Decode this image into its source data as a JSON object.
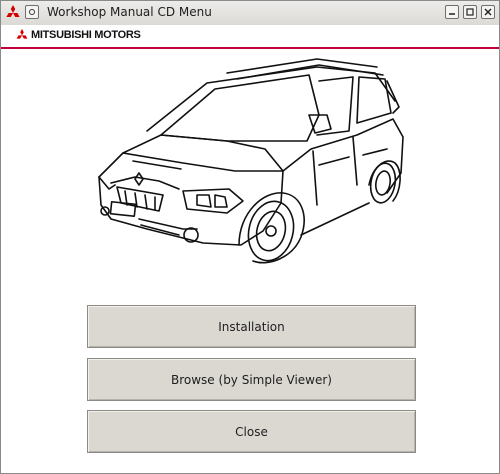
{
  "window": {
    "title": "Workshop Manual CD Menu",
    "controls": [
      "minimize-icon",
      "maximize-icon",
      "close-icon"
    ]
  },
  "brand": {
    "name": "MITSUBISHI MOTORS",
    "accent_color": "#c4003a",
    "logo_color": "#d40000"
  },
  "illustration": {
    "subject": "car-line-drawing-icon"
  },
  "buttons": {
    "install_label": "Installation",
    "browse_label": "Browse (by Simple Viewer)",
    "close_label": "Close"
  },
  "colors": {
    "button_face": "#dbd8d2",
    "titlebar": "#dcdad5"
  }
}
